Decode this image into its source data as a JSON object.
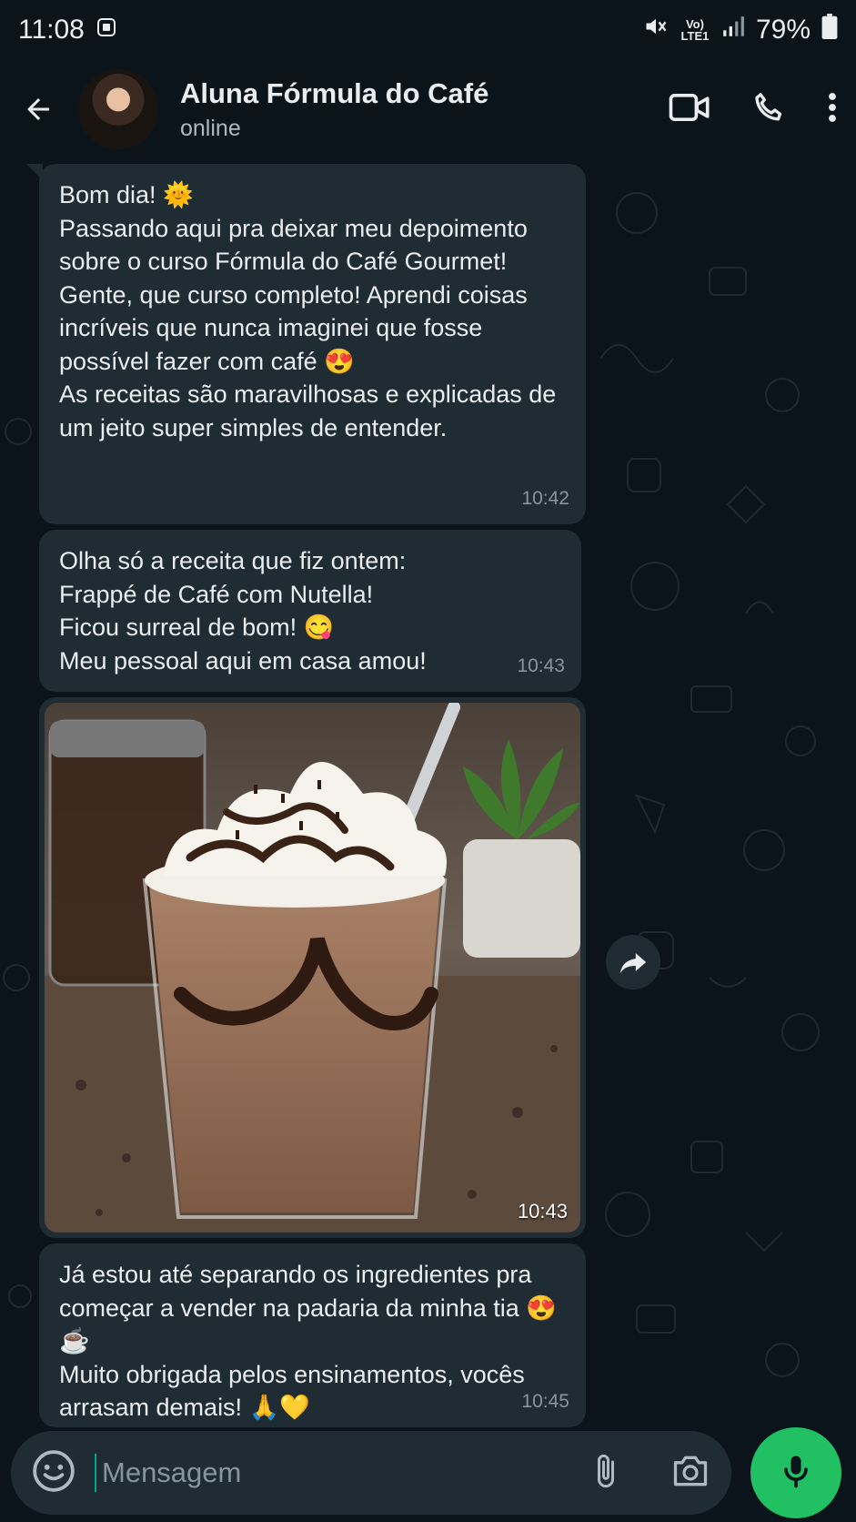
{
  "status_bar": {
    "time": "11:08",
    "network": "Vo) LTE1",
    "battery": "79%"
  },
  "header": {
    "contact_name": "Aluna Fórmula do Café",
    "status": "online"
  },
  "messages": [
    {
      "text": "Bom dia! 🌞\nPassando aqui pra deixar meu depoimento sobre o curso Fórmula do Café Gourmet!\nGente, que curso completo! Aprendi coisas incríveis que nunca imaginei que fosse possível fazer com café 😍\nAs receitas são maravilhosas e explicadas de um jeito super simples de entender.",
      "time": "10:42"
    },
    {
      "text": "Olha só a receita que fiz ontem:\nFrappé de Café com Nutella!\nFicou surreal de bom! 😋\nMeu pessoal aqui em casa amou!",
      "time": "10:43"
    },
    {
      "image": "frappe-photo",
      "time": "10:43"
    },
    {
      "text": "Já estou até separando os ingredientes pra começar a vender na padaria da minha tia 😍☕\nMuito obrigada pelos ensinamentos, vocês arrasam demais! 🙏💛",
      "time": "10:45"
    }
  ],
  "composer": {
    "placeholder": "Mensagem"
  },
  "colors": {
    "background": "#0b141a",
    "bubble": "#202c33",
    "accent": "#21c063"
  }
}
